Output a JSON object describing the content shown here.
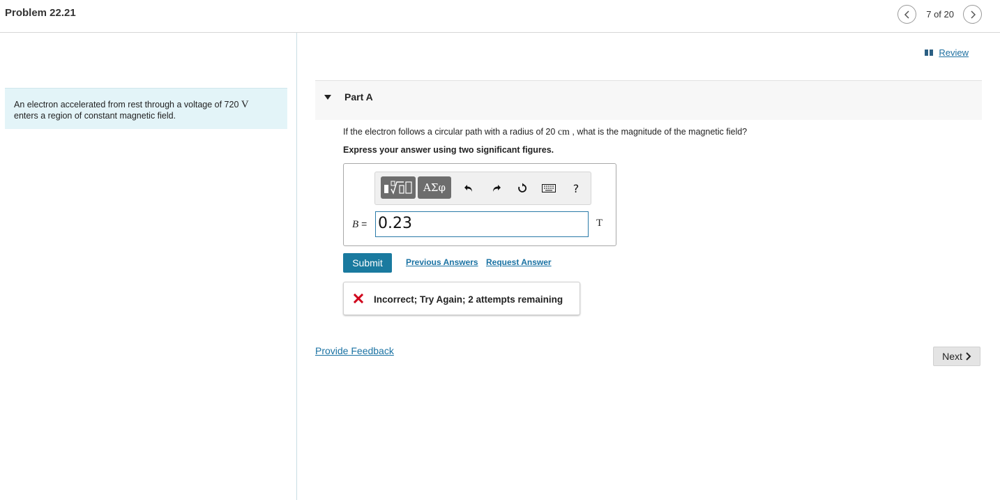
{
  "header": {
    "title": "Problem 22.21",
    "page_counter": "7 of 20"
  },
  "intro": {
    "text": "An electron accelerated from rest through a voltage of 720",
    "unit": "V",
    "text_line2": "enters a region of constant magnetic field."
  },
  "review": {
    "label": "Review"
  },
  "part": {
    "label": "Part A",
    "question_prefix": "If the electron follows a circular path with a radius of 20",
    "question_unit": "cm",
    "question_suffix": ", what is the magnitude of the magnetic field?",
    "instruction": "Express your answer using two significant figures."
  },
  "toolbar": {
    "greek_label": "ΑΣφ",
    "help_label": "?",
    "icons": [
      "templates-icon",
      "undo-icon",
      "redo-icon",
      "reset-icon",
      "keyboard-icon"
    ]
  },
  "answer": {
    "variable": "B",
    "equals": "=",
    "value": "0.23",
    "unit": "T"
  },
  "actions": {
    "submit_label": "Submit",
    "previous_answers_label": "Previous Answers",
    "request_answer_label": "Request Answer"
  },
  "feedback": {
    "message": "Incorrect; Try Again; 2 attempts remaining",
    "status_color": "#d0021b"
  },
  "footer": {
    "provide_feedback_label": "Provide Feedback",
    "next_label": "Next"
  },
  "colors": {
    "accent": "#1a7a9f",
    "link": "#1a72a3",
    "intro_bg": "#e3f4f8"
  }
}
